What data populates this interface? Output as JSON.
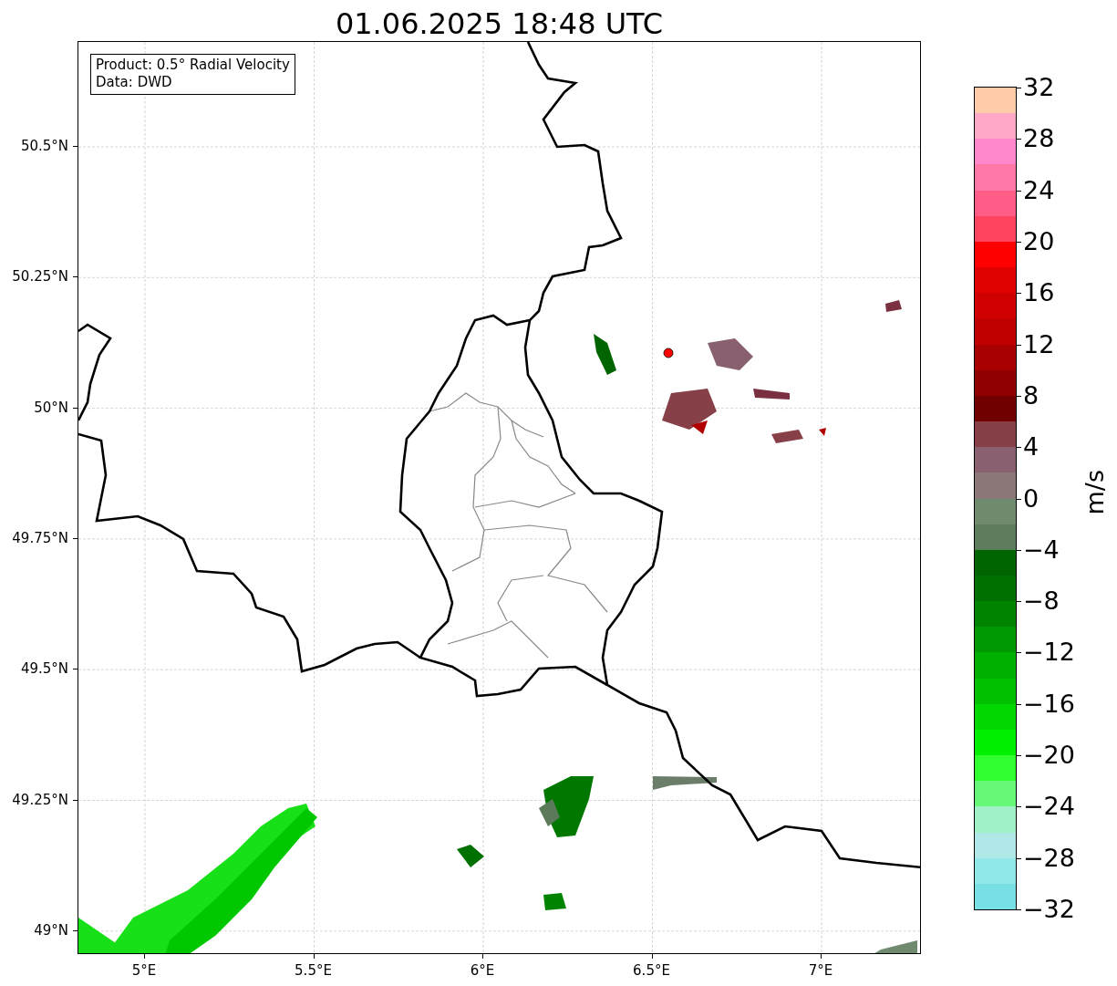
{
  "title": "01.06.2025 18:48 UTC",
  "info_box": {
    "lines": [
      "Product: 0.5° Radial Velocity",
      "Data: DWD"
    ]
  },
  "latitude_labels": [
    "50.5°N",
    "50.25°N",
    "50°N",
    "49.75°N",
    "49.5°N",
    "49.25°N",
    "49°N"
  ],
  "longitude_labels": [
    "5°E",
    "5.5°E",
    "6°E",
    "6.5°E",
    "7°E"
  ],
  "colorbar": {
    "label": "m/s",
    "ticks": [
      "32",
      "28",
      "24",
      "20",
      "16",
      "12",
      "8",
      "4",
      "0",
      "−4",
      "−8",
      "−12",
      "−16",
      "−20",
      "−24",
      "−28",
      "−32"
    ],
    "segments": [
      {
        "color": "#ffcba8"
      },
      {
        "color": "#ffa8c8"
      },
      {
        "color": "#ff88cc"
      },
      {
        "color": "#ff78a8"
      },
      {
        "color": "#ff5c88"
      },
      {
        "color": "#ff4460"
      },
      {
        "color": "#ff0000"
      },
      {
        "color": "#e00000"
      },
      {
        "color": "#d00000"
      },
      {
        "color": "#c00000"
      },
      {
        "color": "#a80000"
      },
      {
        "color": "#900000"
      },
      {
        "color": "#700000"
      },
      {
        "color": "#884048"
      },
      {
        "color": "#886070"
      },
      {
        "color": "#8a7878"
      },
      {
        "color": "#708a70"
      },
      {
        "color": "#5c7c5c"
      },
      {
        "color": "#006400"
      },
      {
        "color": "#007000"
      },
      {
        "color": "#008400"
      },
      {
        "color": "#009800"
      },
      {
        "color": "#00b000"
      },
      {
        "color": "#00c000"
      },
      {
        "color": "#00d800"
      },
      {
        "color": "#00f000"
      },
      {
        "color": "#30ff30"
      },
      {
        "color": "#68f878"
      },
      {
        "color": "#a0f0c8"
      },
      {
        "color": "#b0e8e8"
      },
      {
        "color": "#90e8e8"
      },
      {
        "color": "#78e0e4"
      }
    ]
  }
}
